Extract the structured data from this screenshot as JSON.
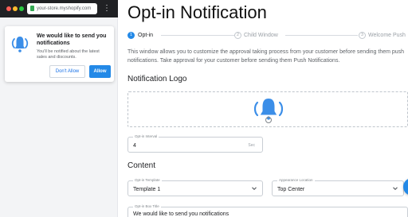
{
  "browser": {
    "url": "your-store.myshopify.com",
    "more_icon": "⋮",
    "dots": [
      "#ff5f57",
      "#febc2e",
      "#28c840"
    ]
  },
  "preview": {
    "title": "We would like to send you notifications",
    "description": "You'll be notified about the latest sales and discounts.",
    "dont_allow": "Don't Allow",
    "allow": "Allow",
    "bell_icon": "bell-icon"
  },
  "page": {
    "title": "Opt-in Notification",
    "intro": "This window allows you to customize the approval taking process from your customer before sending them push notifications. Take approval for your customer before sending them Push Notifications."
  },
  "stepper": {
    "steps": [
      {
        "number": "1",
        "label": "Opt-in",
        "active": true
      },
      {
        "number": "2",
        "label": "Child Window",
        "active": false
      },
      {
        "number": "3",
        "label": "Welcome Push",
        "active": false
      }
    ]
  },
  "logo_section": {
    "title": "Notification Logo"
  },
  "optin_interval": {
    "label": "Opt-in Interval",
    "value": "4",
    "suffix": "Sec"
  },
  "content_section": {
    "title": "Content",
    "template": {
      "label": "Opt-in Template",
      "value": "Template 1"
    },
    "appearance": {
      "label": "Appearance Location",
      "value": "Top Center"
    },
    "box_title": {
      "label": "Opt-in Box Title",
      "value": "We would like to send you notifications"
    }
  },
  "colors": {
    "accent": "#2389e7",
    "bell": "#3b8ee8"
  }
}
